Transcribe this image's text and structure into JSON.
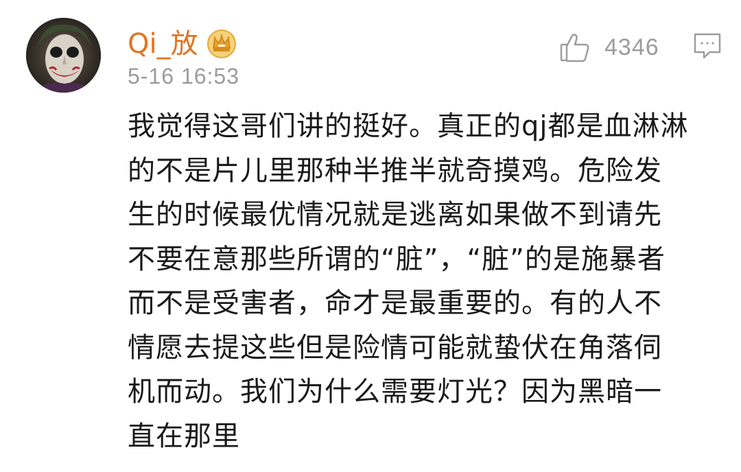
{
  "comment": {
    "username": "Qi_放",
    "timestamp": "5-16 16:53",
    "likes": "4346",
    "text_lines": [
      "我觉得这哥们讲的挺好。真正的qj都是血淋淋",
      "的不是片儿里那种半推半就奇摸鸡。危险发",
      "生的时候最优情况就是逃离如果做不到请先",
      "不要在意那些所谓的“脏”，“脏”的是施暴者",
      "而不是受害者，命才是最重要的。有的人不",
      "情愿去提这些但是险情可能就蛰伏在角落伺",
      "机而动。我们为什么需要灯光？因为黑暗一",
      "直在那里"
    ]
  },
  "icons": {
    "avatar": "joker-avatar",
    "badge": "crown-icon",
    "like": "thumbs-up-icon",
    "reply": "comment-icon"
  },
  "colors": {
    "username": "#e27420",
    "meta": "#9b9b9b",
    "body_text": "#1a1a1a",
    "crown": "#f0b429"
  }
}
